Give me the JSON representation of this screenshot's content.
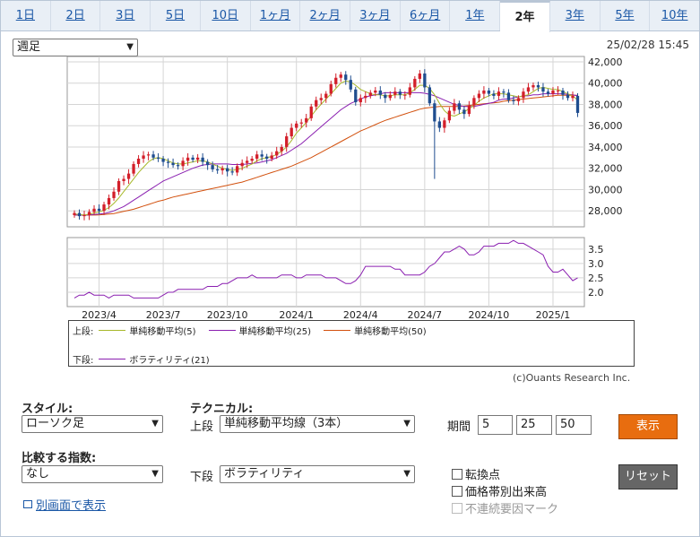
{
  "tabs": [
    "1日",
    "2日",
    "3日",
    "5日",
    "10日",
    "1ヶ月",
    "2ヶ月",
    "3ヶ月",
    "6ヶ月",
    "1年",
    "2年",
    "3年",
    "5年",
    "10年"
  ],
  "active_tab": 10,
  "period_select": "週足",
  "timestamp": "25/02/28 15:45",
  "copyright": "(c)Ouants Research Inc.",
  "legend": {
    "upper_prefix": "上段:",
    "lower_prefix": "下段:",
    "items": [
      {
        "label": "単純移動平均(5)",
        "color": "#a7b82a"
      },
      {
        "label": "単純移動平均(25)",
        "color": "#8a1fb0"
      },
      {
        "label": "単純移動平均(50)",
        "color": "#d2500d"
      },
      {
        "label": "ボラティリティ(21)",
        "color": "#8a1fb0"
      }
    ]
  },
  "chart_data": [
    {
      "type": "candlestick",
      "ylim": [
        26500,
        42500
      ],
      "yticks": [
        "42,000",
        "40,000",
        "38,000",
        "36,000",
        "34,000",
        "32,000",
        "30,000",
        "28,000"
      ],
      "ytick_values": [
        42000,
        40000,
        38000,
        36000,
        34000,
        32000,
        30000,
        28000
      ],
      "xticks": [
        "2023/4",
        "2023/7",
        "2023/10",
        "2024/1",
        "2024/4",
        "2024/7",
        "2024/10",
        "2025/1"
      ],
      "xtick_index": [
        5,
        18,
        31,
        45,
        58,
        71,
        84,
        97
      ],
      "closes": [
        27800,
        27500,
        27600,
        27900,
        28200,
        28000,
        28600,
        29200,
        29800,
        30800,
        31000,
        31500,
        32400,
        32900,
        33200,
        33300,
        33000,
        32900,
        32600,
        32500,
        32300,
        32200,
        32700,
        33000,
        32800,
        33000,
        32600,
        32300,
        31900,
        31800,
        32000,
        31700,
        31600,
        32200,
        32500,
        32700,
        32900,
        33300,
        33100,
        32900,
        33200,
        33600,
        34000,
        35000,
        35800,
        36200,
        36300,
        36700,
        37800,
        38400,
        38600,
        39000,
        39900,
        40500,
        40800,
        40300,
        39400,
        38200,
        38600,
        38800,
        39100,
        39300,
        38900,
        38600,
        38900,
        39200,
        38900,
        38900,
        39600,
        40400,
        40900,
        39600,
        38100,
        36400,
        35800,
        36500,
        37400,
        38100,
        37500,
        37100,
        37900,
        38600,
        39000,
        39300,
        39000,
        38800,
        39200,
        39100,
        38400,
        38300,
        38600,
        39200,
        39600,
        39800,
        39600,
        39200,
        39000,
        39300,
        39300,
        38900,
        38600,
        38800,
        37200
      ],
      "ma5": [
        27700,
        27650,
        27600,
        27680,
        27800,
        27900,
        28050,
        28300,
        28700,
        29200,
        29800,
        30400,
        31000,
        31600,
        32100,
        32600,
        32900,
        33000,
        32900,
        32700,
        32500,
        32400,
        32400,
        32500,
        32600,
        32700,
        32700,
        32600,
        32400,
        32200,
        32000,
        31900,
        31800,
        31900,
        32000,
        32200,
        32400,
        32700,
        32900,
        33000,
        33100,
        33300,
        33600,
        34000,
        34600,
        35300,
        35800,
        36300,
        36900,
        37500,
        38000,
        38500,
        39000,
        39500,
        40000,
        40200,
        40100,
        39800,
        39400,
        39200,
        39000,
        38900,
        38900,
        38800,
        38800,
        38900,
        38900,
        38900,
        39100,
        39400,
        39800,
        39800,
        39500,
        38900,
        38100,
        37400,
        37000,
        36900,
        37100,
        37300,
        37600,
        37900,
        38300,
        38600,
        38800,
        39000,
        39000,
        39000,
        38900,
        38800,
        38700,
        38800,
        38900,
        39200,
        39500,
        39600,
        39500,
        39400,
        39400,
        39200,
        39000,
        38800,
        38400
      ],
      "ma25": [
        27600,
        27600,
        27600,
        27600,
        27650,
        27700,
        27750,
        27850,
        28000,
        28200,
        28400,
        28700,
        29000,
        29300,
        29600,
        29900,
        30200,
        30500,
        30800,
        31000,
        31200,
        31400,
        31600,
        31800,
        32000,
        32150,
        32300,
        32350,
        32400,
        32400,
        32400,
        32400,
        32350,
        32350,
        32350,
        32400,
        32450,
        32500,
        32600,
        32700,
        32800,
        33000,
        33200,
        33400,
        33700,
        34000,
        34300,
        34700,
        35100,
        35500,
        35900,
        36300,
        36700,
        37100,
        37500,
        37800,
        38100,
        38300,
        38500,
        38700,
        38800,
        38900,
        39000,
        39100,
        39100,
        39100,
        39100,
        39100,
        39100,
        39100,
        39100,
        39050,
        38950,
        38800,
        38600,
        38400,
        38200,
        38000,
        37900,
        37800,
        37800,
        37800,
        37900,
        38000,
        38100,
        38200,
        38400,
        38500,
        38500,
        38600,
        38700,
        38800,
        38800,
        38900,
        38900,
        39000,
        39000,
        39000,
        39000,
        39000,
        38950,
        38900,
        38800
      ],
      "ma50": [
        27600,
        27600,
        27600,
        27600,
        27600,
        27620,
        27650,
        27700,
        27750,
        27850,
        27950,
        28050,
        28150,
        28300,
        28450,
        28600,
        28750,
        28900,
        29000,
        29150,
        29300,
        29400,
        29500,
        29600,
        29700,
        29800,
        29900,
        30000,
        30100,
        30200,
        30300,
        30400,
        30500,
        30600,
        30700,
        30850,
        31000,
        31150,
        31300,
        31450,
        31600,
        31750,
        31900,
        32050,
        32200,
        32400,
        32600,
        32800,
        33000,
        33250,
        33500,
        33750,
        34000,
        34250,
        34500,
        34750,
        35000,
        35250,
        35500,
        35700,
        35900,
        36100,
        36300,
        36500,
        36650,
        36800,
        36950,
        37100,
        37250,
        37400,
        37550,
        37650,
        37700,
        37750,
        37800,
        37800,
        37800,
        37800,
        37800,
        37850,
        37900,
        37950,
        38000,
        38050,
        38100,
        38150,
        38200,
        38300,
        38350,
        38400,
        38450,
        38500,
        38550,
        38600,
        38650,
        38700,
        38750,
        38800,
        38850,
        38850,
        38850,
        38850,
        38850
      ],
      "volatility_ylim": [
        1.5,
        3.9
      ],
      "volatility_yticks": [
        "3.5",
        "3.0",
        "2.5",
        "2.0"
      ],
      "volatility_ytick_values": [
        3.5,
        3.0,
        2.5,
        2.0
      ],
      "volatility": [
        1.8,
        1.9,
        1.9,
        2.0,
        1.9,
        1.9,
        1.9,
        1.8,
        1.9,
        1.9,
        1.9,
        1.9,
        1.8,
        1.8,
        1.8,
        1.8,
        1.8,
        1.8,
        1.9,
        2.0,
        2.0,
        2.1,
        2.1,
        2.1,
        2.1,
        2.1,
        2.1,
        2.2,
        2.2,
        2.2,
        2.3,
        2.3,
        2.4,
        2.5,
        2.5,
        2.5,
        2.6,
        2.5,
        2.5,
        2.5,
        2.5,
        2.5,
        2.6,
        2.6,
        2.6,
        2.5,
        2.5,
        2.6,
        2.6,
        2.6,
        2.6,
        2.5,
        2.5,
        2.5,
        2.4,
        2.3,
        2.3,
        2.4,
        2.6,
        2.9,
        2.9,
        2.9,
        2.9,
        2.9,
        2.9,
        2.8,
        2.8,
        2.6,
        2.6,
        2.6,
        2.6,
        2.7,
        2.9,
        3.0,
        3.2,
        3.4,
        3.4,
        3.5,
        3.6,
        3.5,
        3.3,
        3.3,
        3.4,
        3.6,
        3.6,
        3.6,
        3.7,
        3.7,
        3.7,
        3.8,
        3.7,
        3.7,
        3.6,
        3.5,
        3.4,
        3.3,
        2.9,
        2.7,
        2.7,
        2.8,
        2.6,
        2.4,
        2.5
      ]
    }
  ],
  "controls": {
    "style_label": "スタイル:",
    "style_value": "ローソク足",
    "technical_label": "テクニカル:",
    "upper_label": "上段",
    "upper_value": "単純移動平均線（3本）",
    "period_label": "期間",
    "period_values": [
      "5",
      "25",
      "50"
    ],
    "show_button": "表示",
    "compare_label": "比較する指数:",
    "compare_value": "なし",
    "lower_label": "下段",
    "lower_value": "ボラティリティ",
    "checkboxes": [
      {
        "label": "転換点",
        "disabled": false
      },
      {
        "label": "価格帯別出来高",
        "disabled": false
      },
      {
        "label": "不連続要因マーク",
        "disabled": true
      }
    ],
    "reset_button": "リセット",
    "separate_window_link": "別画面で表示"
  },
  "colors": {
    "up": "#d31f2a",
    "down": "#1f4d8f",
    "accent": "#e86d0f"
  }
}
